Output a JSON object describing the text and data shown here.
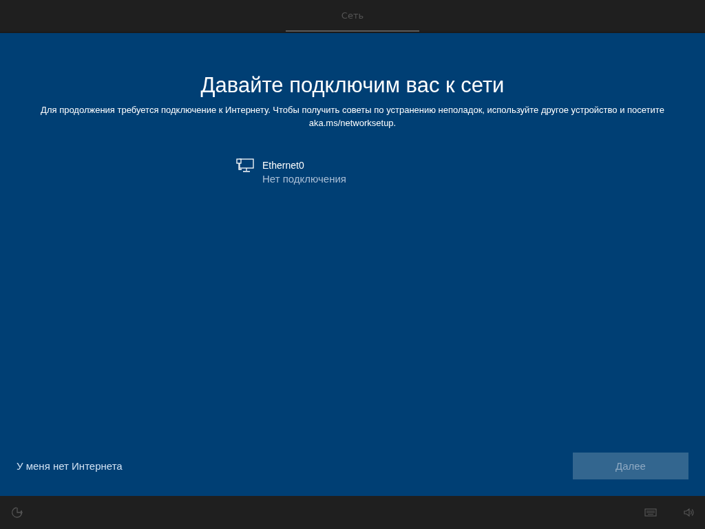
{
  "header": {
    "tabs": [
      {
        "label": "Сеть",
        "selected": true
      }
    ]
  },
  "title": "Давайте подключим вас к сети",
  "description": "Для продолжения требуется подключение к Интернету. Чтобы получить советы по устранению неполадок, используйте другое устройство и посетите aka.ms/networksetup.",
  "networks": [
    {
      "name": "Ethernet0",
      "status": "Нет подключения"
    }
  ],
  "footer": {
    "skip_link": "У меня нет Интернета",
    "next_button": {
      "label": "Далее",
      "disabled": true
    }
  }
}
